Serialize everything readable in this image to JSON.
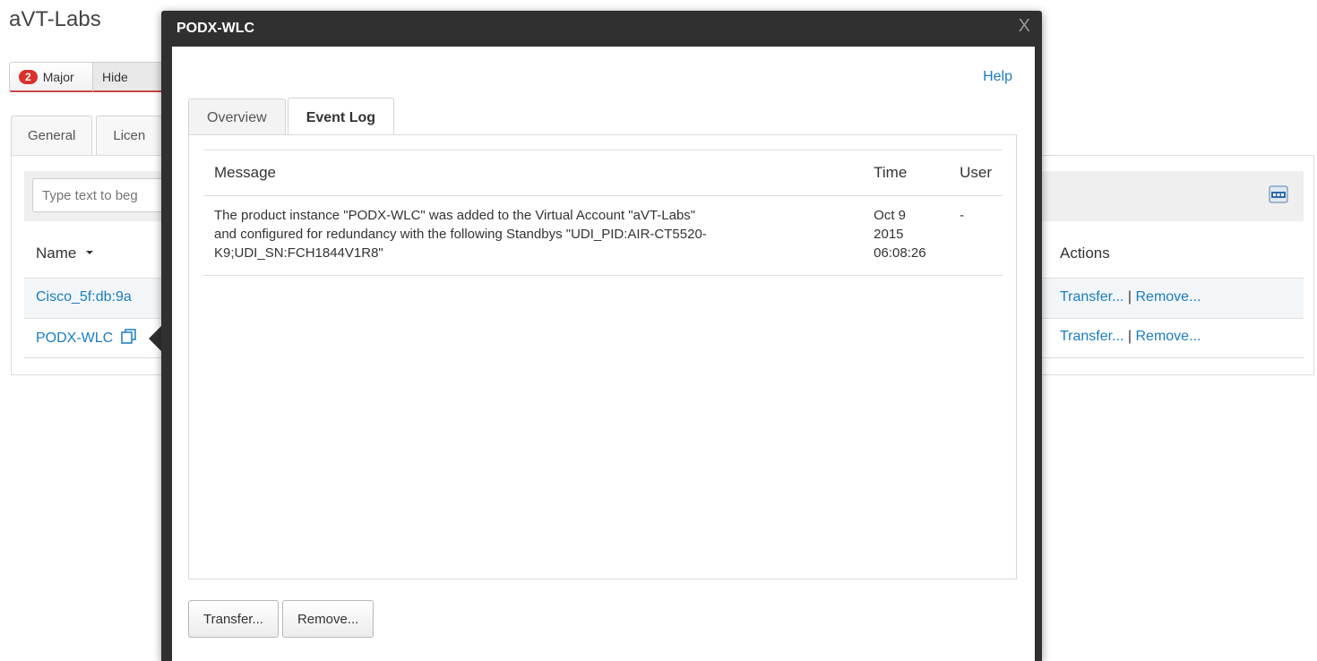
{
  "page": {
    "title": "aVT-Labs",
    "alerts": {
      "count": "2",
      "major_label": "Major",
      "hide_label": "Hide"
    },
    "tabs": [
      {
        "label": "General"
      },
      {
        "label": "Licen"
      }
    ],
    "filter": {
      "placeholder": "Type text to beg"
    },
    "table": {
      "headers": {
        "name": "Name",
        "actions": "Actions"
      },
      "rows": [
        {
          "name": "Cisco_5f:db:9a",
          "transfer": "Transfer...",
          "separator": "|",
          "remove": "Remove..."
        },
        {
          "name": "PODX-WLC",
          "transfer": "Transfer...",
          "separator": "|",
          "remove": "Remove..."
        }
      ]
    },
    "icons": {
      "sort": "caret-down-icon",
      "export": "csv-icon",
      "copy": "copy-icon"
    }
  },
  "modal": {
    "title": "PODX-WLC",
    "close": "X",
    "help": "Help",
    "tabs": [
      {
        "label": "Overview",
        "active": false
      },
      {
        "label": "Event Log",
        "active": true
      }
    ],
    "event_log": {
      "headers": {
        "message": "Message",
        "time": "Time",
        "user": "User"
      },
      "rows": [
        {
          "message_line1": "The product instance \"PODX-WLC\" was added to the Virtual Account \"aVT-Labs\"",
          "message_line2": "and configured for redundancy with the following Standbys \"UDI_PID:AIR-CT5520-",
          "message_line3": "K9;UDI_SN:FCH1844V1R8\"",
          "time_line1": "Oct 9",
          "time_line2": "2015",
          "time_line3": "06:08:26",
          "user": "-"
        }
      ]
    },
    "buttons": {
      "transfer": "Transfer...",
      "remove": "Remove..."
    }
  },
  "colors": {
    "link": "#1a7dc0",
    "alert_badge": "#d9312b",
    "modal_header": "#303030"
  }
}
